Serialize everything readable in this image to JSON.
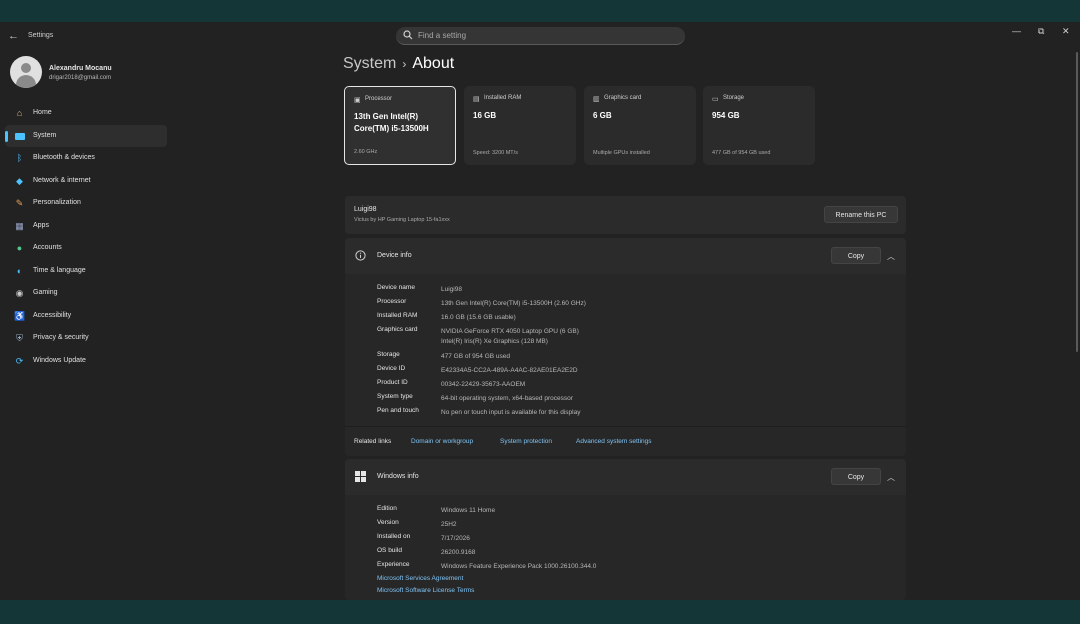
{
  "window": {
    "title": "Settings",
    "back_icon": "back-arrow-icon",
    "minimize": "—",
    "maximize": "⧉",
    "close": "✕"
  },
  "search": {
    "placeholder": "Find a setting"
  },
  "profile": {
    "name": "Alexandru Mocanu",
    "email": "drigar2018@gmail.com"
  },
  "nav": {
    "items": [
      {
        "label": "Home",
        "icon": "home-icon"
      },
      {
        "label": "System",
        "icon": "system-icon",
        "active": true
      },
      {
        "label": "Bluetooth & devices",
        "icon": "bluetooth-icon"
      },
      {
        "label": "Network & internet",
        "icon": "wifi-icon"
      },
      {
        "label": "Personalization",
        "icon": "brush-icon"
      },
      {
        "label": "Apps",
        "icon": "apps-icon"
      },
      {
        "label": "Accounts",
        "icon": "accounts-icon"
      },
      {
        "label": "Time & language",
        "icon": "globe-icon"
      },
      {
        "label": "Gaming",
        "icon": "gamepad-icon"
      },
      {
        "label": "Accessibility",
        "icon": "accessibility-icon"
      },
      {
        "label": "Privacy & security",
        "icon": "shield-icon"
      },
      {
        "label": "Windows Update",
        "icon": "update-icon"
      }
    ]
  },
  "breadcrumb": {
    "parent": "System",
    "sep": "›",
    "current": "About"
  },
  "spec_cards": [
    {
      "title": "Processor",
      "value": "13th Gen Intel(R) Core(TM) i5-13500H",
      "sub": "2.60 GHz"
    },
    {
      "title": "Installed RAM",
      "value": "16 GB",
      "sub": "Speed: 3200 MT/s"
    },
    {
      "title": "Graphics card",
      "value": "6 GB",
      "sub": "Multiple GPUs installed"
    },
    {
      "title": "Storage",
      "value": "954 GB",
      "sub": "477 GB of 954 GB used"
    }
  ],
  "pc": {
    "name": "Luigi98",
    "model": "Victus by HP Gaming Laptop 15-fa1xxx",
    "rename_label": "Rename this PC"
  },
  "device_info": {
    "title": "Device info",
    "copy_label": "Copy",
    "rows": [
      {
        "label": "Device name",
        "value": "Luigi98",
        "value2": ""
      },
      {
        "label": "Processor",
        "value": "13th Gen Intel(R) Core(TM) i5-13500H (2.60 GHz)",
        "value2": ""
      },
      {
        "label": "Installed RAM",
        "value": "16.0 GB (15.6 GB usable)",
        "value2": ""
      },
      {
        "label": "Graphics card",
        "value": "NVIDIA GeForce RTX 4050 Laptop GPU (6 GB)",
        "value2": "Intel(R) Iris(R) Xe Graphics (128 MB)"
      },
      {
        "label": "Storage",
        "value": "477 GB of 954 GB used",
        "value2": ""
      },
      {
        "label": "Device ID",
        "value": "E42334A5-CC2A-489A-A4AC-82AE01EA2E2D",
        "value2": ""
      },
      {
        "label": "Product ID",
        "value": "00342-22429-35673-AAOEM",
        "value2": ""
      },
      {
        "label": "System type",
        "value": "64-bit operating system, x64-based processor",
        "value2": ""
      },
      {
        "label": "Pen and touch",
        "value": "No pen or touch input is available for this display",
        "value2": ""
      }
    ],
    "related_label": "Related links",
    "related_links": [
      "Domain or workgroup",
      "System protection",
      "Advanced system settings"
    ]
  },
  "windows_info": {
    "title": "Windows info",
    "copy_label": "Copy",
    "rows": [
      {
        "label": "Edition",
        "value": "Windows 11 Home"
      },
      {
        "label": "Version",
        "value": "25H2"
      },
      {
        "label": "Installed on",
        "value": "7/17/2026"
      },
      {
        "label": "OS build",
        "value": "26200.9168"
      },
      {
        "label": "Experience",
        "value": "Windows Feature Experience Pack 1000.26100.344.0"
      }
    ],
    "links": [
      "Microsoft Services Agreement",
      "Microsoft Software License Terms"
    ]
  }
}
